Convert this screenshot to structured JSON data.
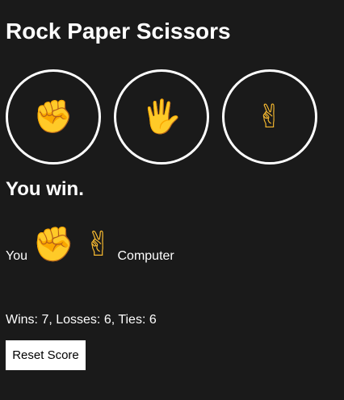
{
  "game": {
    "title": "Rock Paper Scissors",
    "choices": [
      {
        "name": "rock",
        "icon": "raised-fist-icon",
        "glyph": "✊"
      },
      {
        "name": "paper",
        "icon": "raised-hand-icon",
        "glyph": "🖐"
      },
      {
        "name": "scissors",
        "icon": "victory-hand-icon",
        "glyph": "✌"
      }
    ],
    "result": "You win.",
    "moves": {
      "player_label": "You",
      "player_glyph": "✊",
      "computer_glyph": "✌",
      "computer_label": "Computer"
    },
    "score": "Wins: 7, Losses: 6, Ties: 6",
    "reset_label": "Reset Score"
  },
  "colors": {
    "background": "#1a1a1a",
    "text": "#ffffff",
    "emoji": "#f5b830",
    "button_bg": "#ffffff",
    "button_text": "#000000"
  }
}
